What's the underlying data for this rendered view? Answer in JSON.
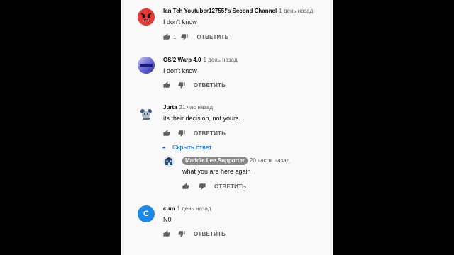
{
  "colors": {
    "link_blue": "#065fd4",
    "text_secondary": "#606060",
    "chip_gray": "#888888",
    "avatar_c": "#1e88e5",
    "avatar_red": "#e53935"
  },
  "comments": [
    {
      "author": "Ian Teh Youtuber12755!'s Second Channel",
      "time": "1 день назад",
      "text": "I don't know",
      "likes": "1",
      "reply_label": "ОТВЕТИТЬ",
      "avatar_icon": "red-angry-face-icon"
    },
    {
      "author": "OS/2 Warp 4.0",
      "time": "1 день назад",
      "text": "I don't know",
      "likes": "",
      "reply_label": "ОТВЕТИТЬ",
      "avatar_icon": "os2-warp-icon"
    },
    {
      "author": "Jurta",
      "time": "21 час назад",
      "text": "its their decision, not yours.",
      "likes": "",
      "reply_label": "ОТВЕТИТЬ",
      "avatar_icon": "character-icon"
    },
    {
      "author": "cum",
      "time": "1 день назад",
      "text": "N0",
      "likes": "",
      "reply_label": "ОТВЕТИТЬ",
      "avatar_icon": "letter-avatar-icon",
      "avatar_letter": "C"
    }
  ],
  "hide_replies_label": "Скрыть ответ",
  "reply": {
    "author": "Maddie Lee Supporter",
    "time": "20 часов назад",
    "text": "what you are here again",
    "reply_label": "ОТВЕТИТЬ",
    "avatar_icon": "building-avatar-icon"
  }
}
